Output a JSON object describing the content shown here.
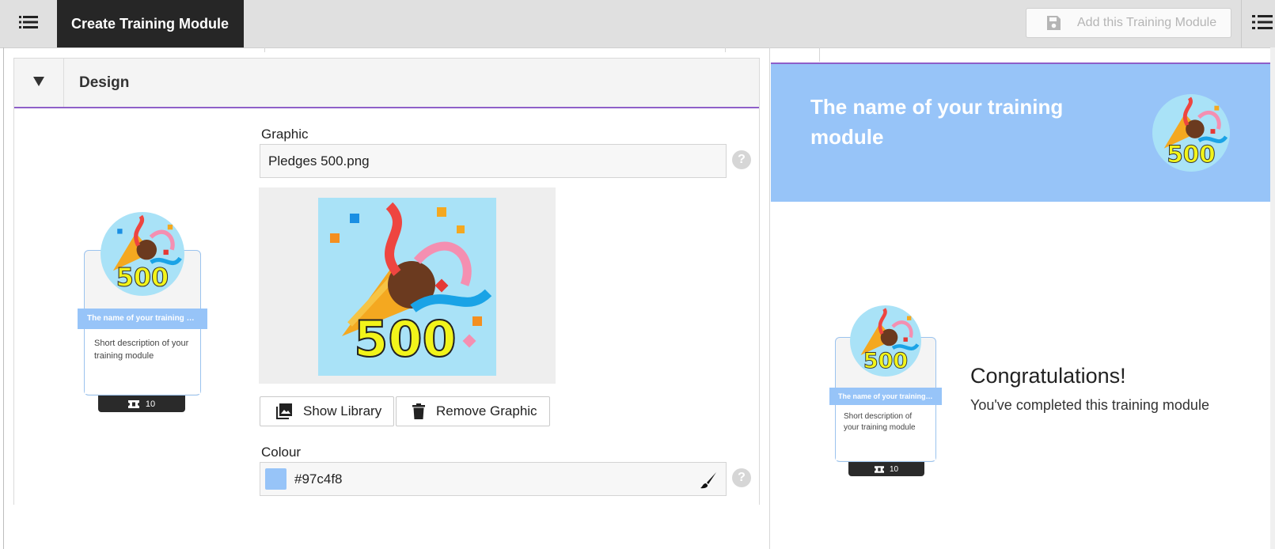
{
  "topbar": {
    "menu_icon": "menu-lines-icon",
    "title": "Create Training Module",
    "add_button_label": "Add this Training Module",
    "add_button_icon": "save-disk-icon",
    "list_icon": "list-icon"
  },
  "design": {
    "section_title": "Design",
    "collapse_icon": "triangle-down-icon",
    "graphic_label": "Graphic",
    "graphic_value": "Pledges 500.png",
    "graphic_image_number": "500",
    "show_library_label": "Show Library",
    "show_library_icon": "image-library-icon",
    "remove_graphic_label": "Remove Graphic",
    "remove_graphic_icon": "trash-icon",
    "colour_label": "Colour",
    "colour_value": "#97c4f8",
    "colour_picker_icon": "paint-brush-icon",
    "help_icon": "question-mark-icon",
    "help_text": "?"
  },
  "badge": {
    "name": "The name of your training module",
    "description": "Short description of your training module",
    "points": "10",
    "points_icon": "ticket-icon",
    "image_number": "500"
  },
  "preview": {
    "title": "The name of your training module",
    "congrats_title": "Congratulations!",
    "congrats_text": "You've completed this training module",
    "accent_color": "#97c4f8",
    "divider_color": "#8e5fc9"
  }
}
